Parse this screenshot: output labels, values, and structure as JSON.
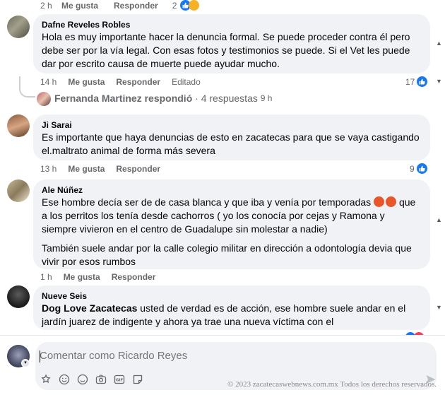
{
  "top_actions": {
    "time": "2 h",
    "like": "Me gusta",
    "reply": "Responder",
    "count": "2"
  },
  "comments": [
    {
      "author": "Dafne Reveles Robles",
      "text": "Hola es muy importante hacer la denuncia formal. Se puede proceder contra él pero debe ser por la vía legal. Con esas fotos y testimonios se puede. Si el Vet les puede dar por escrito causa de muerte puede ayudar mucho.",
      "time": "14 h",
      "like": "Me gusta",
      "reply": "Responder",
      "edited": "Editado",
      "reactions": "17"
    },
    {
      "author": "Ji Sarai",
      "text": "Es importante que haya denuncias de esto en zacatecas para que se vaya castigando el.maltrato animal de forma más severa",
      "time": "13 h",
      "like": "Me gusta",
      "reply": "Responder",
      "reactions": "9"
    },
    {
      "author": "Ale Núñez",
      "text_a": "Ese hombre decía ser de de casa blanca y que iba y venía por temporadas",
      "text_b": "que a los perritos los tenía desde cachorros ( yo los conocía por cejas y Ramona y siempre vivieron en el centro de Guadalupe sin molestar a nadie)",
      "text2": "También suele andar por la calle colegio militar en dirección a odontología devia que vivir por esos rumbos",
      "time": "1 h",
      "like": "Me gusta",
      "reply": "Responder"
    },
    {
      "author": "Nueve Seis",
      "mention": "Dog Love Zacatecas",
      "text": "usted de verdad es de acción, ese hombre suele andar en el jardín juarez de indigente y ahora ya trae una nueva víctima con el"
    }
  ],
  "replied": {
    "name": "Fernanda Martinez respondió",
    "count": "· 4 respuestas",
    "time": "9 h"
  },
  "composer": {
    "placeholder": "Comentar como Ricardo Reyes"
  },
  "watermark": "© 2023 zacatecaswebnews.com.mx Todos los derechos reservados.",
  "colors": {
    "accent": "#1877f2",
    "bubble": "#f0f2f5",
    "muted": "#65676b"
  }
}
